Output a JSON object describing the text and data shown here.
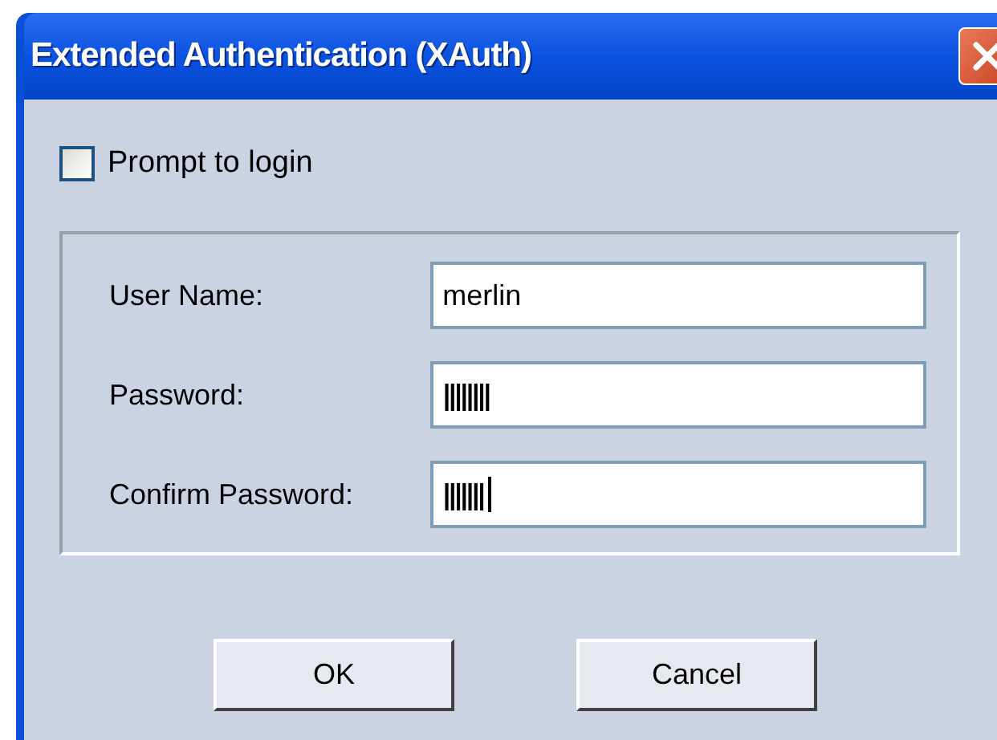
{
  "window": {
    "title": "Extended Authentication (XAuth)"
  },
  "prompt_checkbox": {
    "label": "Prompt to login",
    "checked": false
  },
  "fields": [
    {
      "label": "User Name:",
      "value": "merlin",
      "focused": false
    },
    {
      "label": "Password:",
      "value": "||||||||",
      "focused": false
    },
    {
      "label": "Confirm Password:",
      "value": "|||||||",
      "focused": true
    }
  ],
  "buttons": [
    "OK",
    "Cancel"
  ]
}
